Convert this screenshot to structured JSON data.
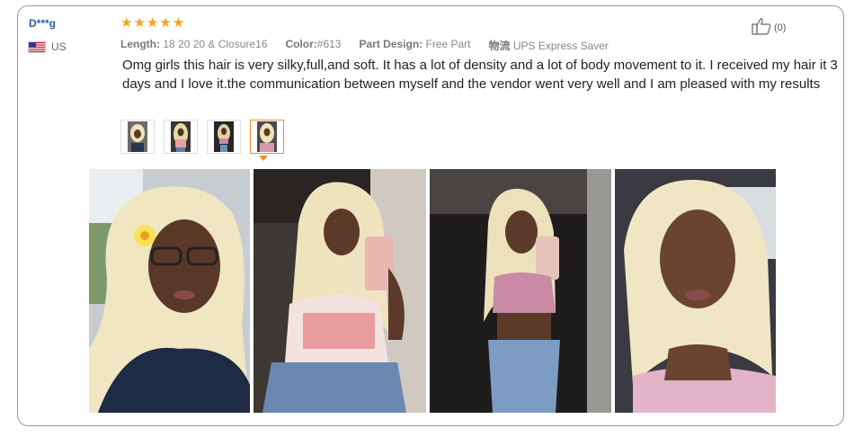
{
  "user": {
    "name": "D***g",
    "country": "US"
  },
  "rating": {
    "stars": 5,
    "max": 5
  },
  "attributes": [
    {
      "label": "Length:",
      "value": "18 20 20 & Closure16"
    },
    {
      "label": "Color:",
      "value": "#613"
    },
    {
      "label": "Part Design:",
      "value": "Free Part"
    },
    {
      "label": "物流",
      "value": "UPS Express Saver"
    }
  ],
  "review": {
    "text": "Omg girls this hair is very silky,full,and soft. It has a lot of density and a lot of body movement to it. I received my hair it 3 days and I love it.the communication between myself and the vendor went very well and I am pleased with my results"
  },
  "helpful": {
    "count": "(0)"
  },
  "thumbnails": {
    "selected_index": 3
  },
  "colors": {
    "accent": "#f08c28",
    "star": "#f7a21b",
    "username": "#2f5fa8"
  }
}
